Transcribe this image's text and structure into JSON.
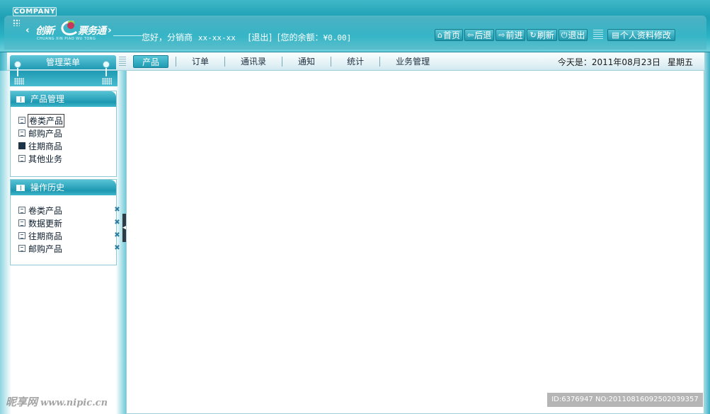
{
  "header": {
    "company": "COMPANY",
    "logo_text_1": "创新",
    "logo_text_2": "票务通",
    "logo_pinyin": "CHUANG XIN PIAO WU TONG",
    "welcome": "您好，分销商",
    "user": "xx-xx-xx",
    "logout": "[退出]",
    "balance_label": "[您的余额：",
    "balance_amount": "¥0.00]"
  },
  "toolbar": [
    {
      "label": "首页",
      "icon": "home-icon",
      "glyph": "⌂"
    },
    {
      "label": "后退",
      "icon": "back-icon",
      "glyph": "⇦"
    },
    {
      "label": "前进",
      "icon": "forward-icon",
      "glyph": "⇨"
    },
    {
      "label": "刷新",
      "icon": "refresh-icon",
      "glyph": "↻"
    },
    {
      "label": "退出",
      "icon": "power-icon",
      "glyph": "⏻"
    }
  ],
  "profile_button": "个人资料修改",
  "nav": {
    "menu_title": "管理菜单",
    "tabs": [
      "产品",
      "订单",
      "通讯录",
      "通知",
      "统计",
      "业务管理"
    ],
    "active_tab": "产品",
    "date": "今天是：2011年08月23日",
    "weekday": "星期五"
  },
  "sidebar": {
    "product_panel": {
      "title": "产品管理",
      "items": [
        "卷类产品",
        "邮购产品",
        "往期商品",
        "其他业务"
      ]
    },
    "history_panel": {
      "title": "操作历史",
      "items": [
        "卷类产品",
        "数据更新",
        "往期商品",
        "邮购产品"
      ]
    }
  },
  "watermark": {
    "site": "昵享网",
    "url": "www.nipic.cn",
    "id": "ID:6376947 NO:20110816092502039357"
  },
  "colors": {
    "accent": "#1d9fb4",
    "header_light": "#6fd0dc",
    "panel_border": "#8ccad6"
  }
}
